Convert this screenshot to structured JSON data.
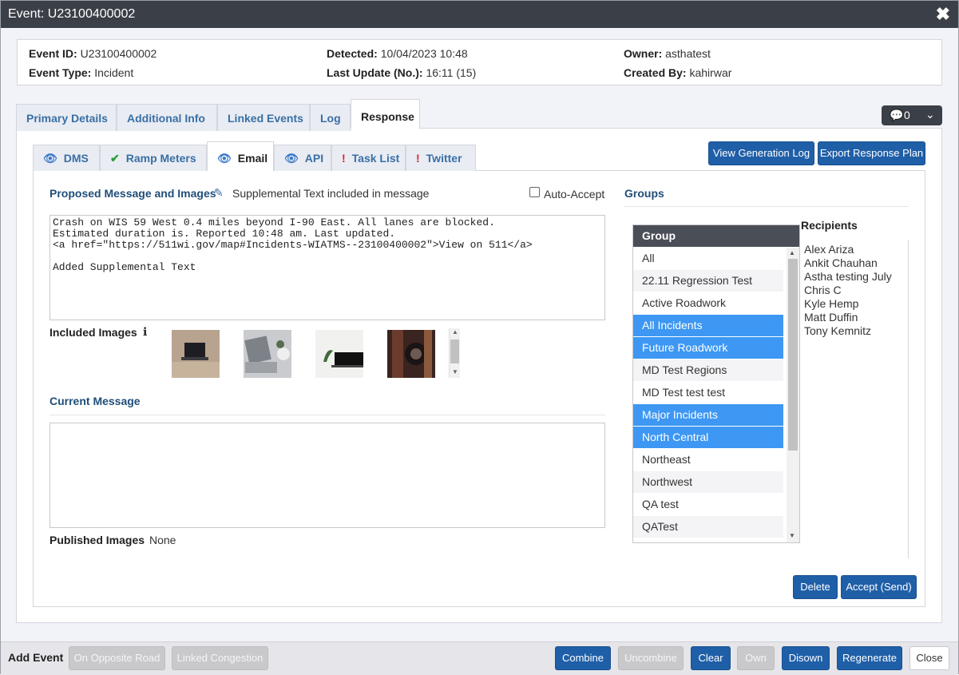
{
  "window": {
    "title": "Event: U23100400002",
    "close_icon": "close-icon"
  },
  "summary": {
    "event_id_label": "Event ID:",
    "event_id": "U23100400002",
    "event_type_label": "Event Type:",
    "event_type": "Incident",
    "detected_label": "Detected:",
    "detected": "10/04/2023 10:48",
    "last_update_label": "Last Update (No.):",
    "last_update": "16:11 (15)",
    "owner_label": "Owner:",
    "owner": "asthatest",
    "created_by_label": "Created By:",
    "created_by": "kahirwar"
  },
  "main_tabs": [
    {
      "label": "Primary Details"
    },
    {
      "label": "Additional Info"
    },
    {
      "label": "Linked Events"
    },
    {
      "label": "Log"
    },
    {
      "label": "Response",
      "active": true
    }
  ],
  "chat": {
    "count": "0",
    "icon": "comment-icon",
    "caret": "chevron-down-icon"
  },
  "sub_tabs": [
    {
      "label": "DMS",
      "icon": "eye-icon"
    },
    {
      "label": "Ramp Meters",
      "icon": "check-icon"
    },
    {
      "label": "Email",
      "icon": "eye-icon",
      "active": true
    },
    {
      "label": "API",
      "icon": "eye-icon"
    },
    {
      "label": "Task List",
      "icon": "exclamation-icon"
    },
    {
      "label": "Twitter",
      "icon": "exclamation-icon"
    }
  ],
  "actions": {
    "view_generation_log": "View Generation Log",
    "export_response_plan": "Export Response Plan"
  },
  "proposed": {
    "heading": "Proposed Message and Images",
    "edit_icon": "pencil-icon",
    "supplemental_note": "Supplemental Text included in message",
    "auto_accept_label": "Auto-Accept",
    "auto_accept_checked": false,
    "message": "Crash on WIS 59 West 0.4 miles beyond I-90 East. All lanes are blocked.\nEstimated duration is. Reported 10:48 am. Last updated.\n<a href=\"https://511wi.gov/map#Incidents-WIATMS--23100400002\">View on 511</a>\n\nAdded Supplemental Text"
  },
  "included_images": {
    "label": "Included Images",
    "info_icon": "info-icon",
    "images": [
      "laptop-on-desk-image",
      "laptop-with-plant-image",
      "laptop-white-desk-image",
      "camera-lens-image"
    ]
  },
  "current_message": {
    "heading": "Current Message",
    "value": ""
  },
  "published_images": {
    "label": "Published Images",
    "value": "None"
  },
  "groups": {
    "heading": "Groups",
    "column_header": "Group",
    "rows": [
      {
        "name": "All",
        "selected": false
      },
      {
        "name": "22.11 Regression Test",
        "selected": false
      },
      {
        "name": "Active Roadwork",
        "selected": false
      },
      {
        "name": "All Incidents",
        "selected": true
      },
      {
        "name": "Future Roadwork",
        "selected": true
      },
      {
        "name": "MD Test Regions",
        "selected": false
      },
      {
        "name": "MD Test test test",
        "selected": false
      },
      {
        "name": "Major Incidents",
        "selected": true
      },
      {
        "name": "North Central",
        "selected": true
      },
      {
        "name": "Northeast",
        "selected": false
      },
      {
        "name": "Northwest",
        "selected": false
      },
      {
        "name": "QA test",
        "selected": false
      },
      {
        "name": "QATest",
        "selected": false
      }
    ]
  },
  "recipients": {
    "heading": "Recipients",
    "names": [
      "Alex Ariza",
      "Ankit Chauhan",
      "Astha testing July",
      "Chris C",
      "Kyle Hemp",
      "Matt Duffin",
      "Tony Kemnitz"
    ]
  },
  "panel_buttons": {
    "delete": "Delete",
    "accept": "Accept (Send)"
  },
  "footer": {
    "add_event_label": "Add Event",
    "on_opposite_road": "On Opposite Road",
    "linked_congestion": "Linked Congestion",
    "combine": "Combine",
    "uncombine": "Uncombine",
    "clear": "Clear",
    "own": "Own",
    "disown": "Disown",
    "regenerate": "Regenerate",
    "close": "Close"
  }
}
